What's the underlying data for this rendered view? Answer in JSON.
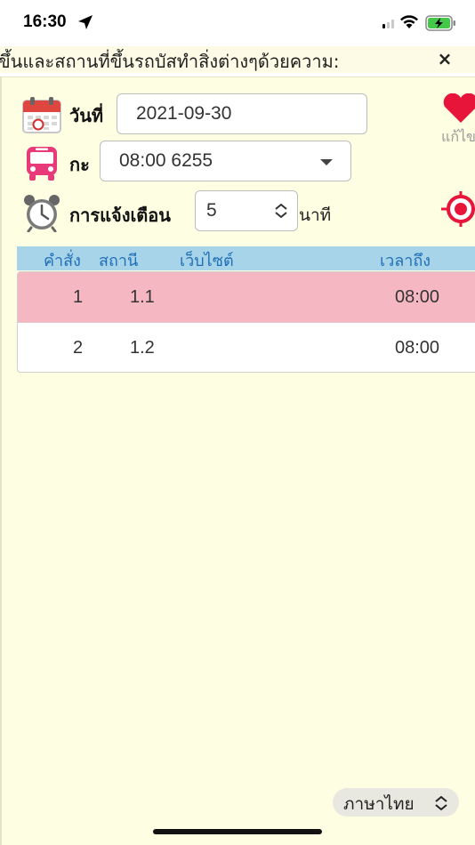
{
  "status_bar": {
    "time": "16:30"
  },
  "marquee": {
    "text": "ขึ้นและสถานที่ขึ้นรถบัสทำสิ่งต่างๆด้วยความ:",
    "close_label": "×"
  },
  "form": {
    "date_label": "วันที่",
    "date_value": "2021-09-30",
    "shift_label": "กะ",
    "shift_value": "08:00 6255",
    "alert_label": "การแจ้งเตือน",
    "alert_value": "5",
    "alert_unit": "นาที",
    "edit_label": "แก้ไข"
  },
  "table": {
    "columns": [
      "คำสั่ง",
      "สถานี",
      "เว็บไซต์",
      "เวลาถึง"
    ],
    "rows": [
      {
        "order": "1",
        "station": "1.1",
        "website": "",
        "arrival": "08:00",
        "selected": true
      },
      {
        "order": "2",
        "station": "1.2",
        "website": "",
        "arrival": "08:00",
        "selected": false
      }
    ]
  },
  "footer": {
    "language_label": "ภาษาไทย"
  },
  "colors": {
    "background": "#fefee2",
    "header_bg": "#a8d4ea",
    "header_text": "#1f6fb5",
    "selected_row": "#f5b8c2",
    "accent_red": "#e8153a"
  },
  "icons": [
    "location-arrow-icon",
    "cellular-signal-icon",
    "wifi-icon",
    "battery-charging-icon",
    "calendar-icon",
    "bus-icon",
    "alarm-clock-icon",
    "heart-icon",
    "target-icon",
    "chevron-updown-icon"
  ]
}
